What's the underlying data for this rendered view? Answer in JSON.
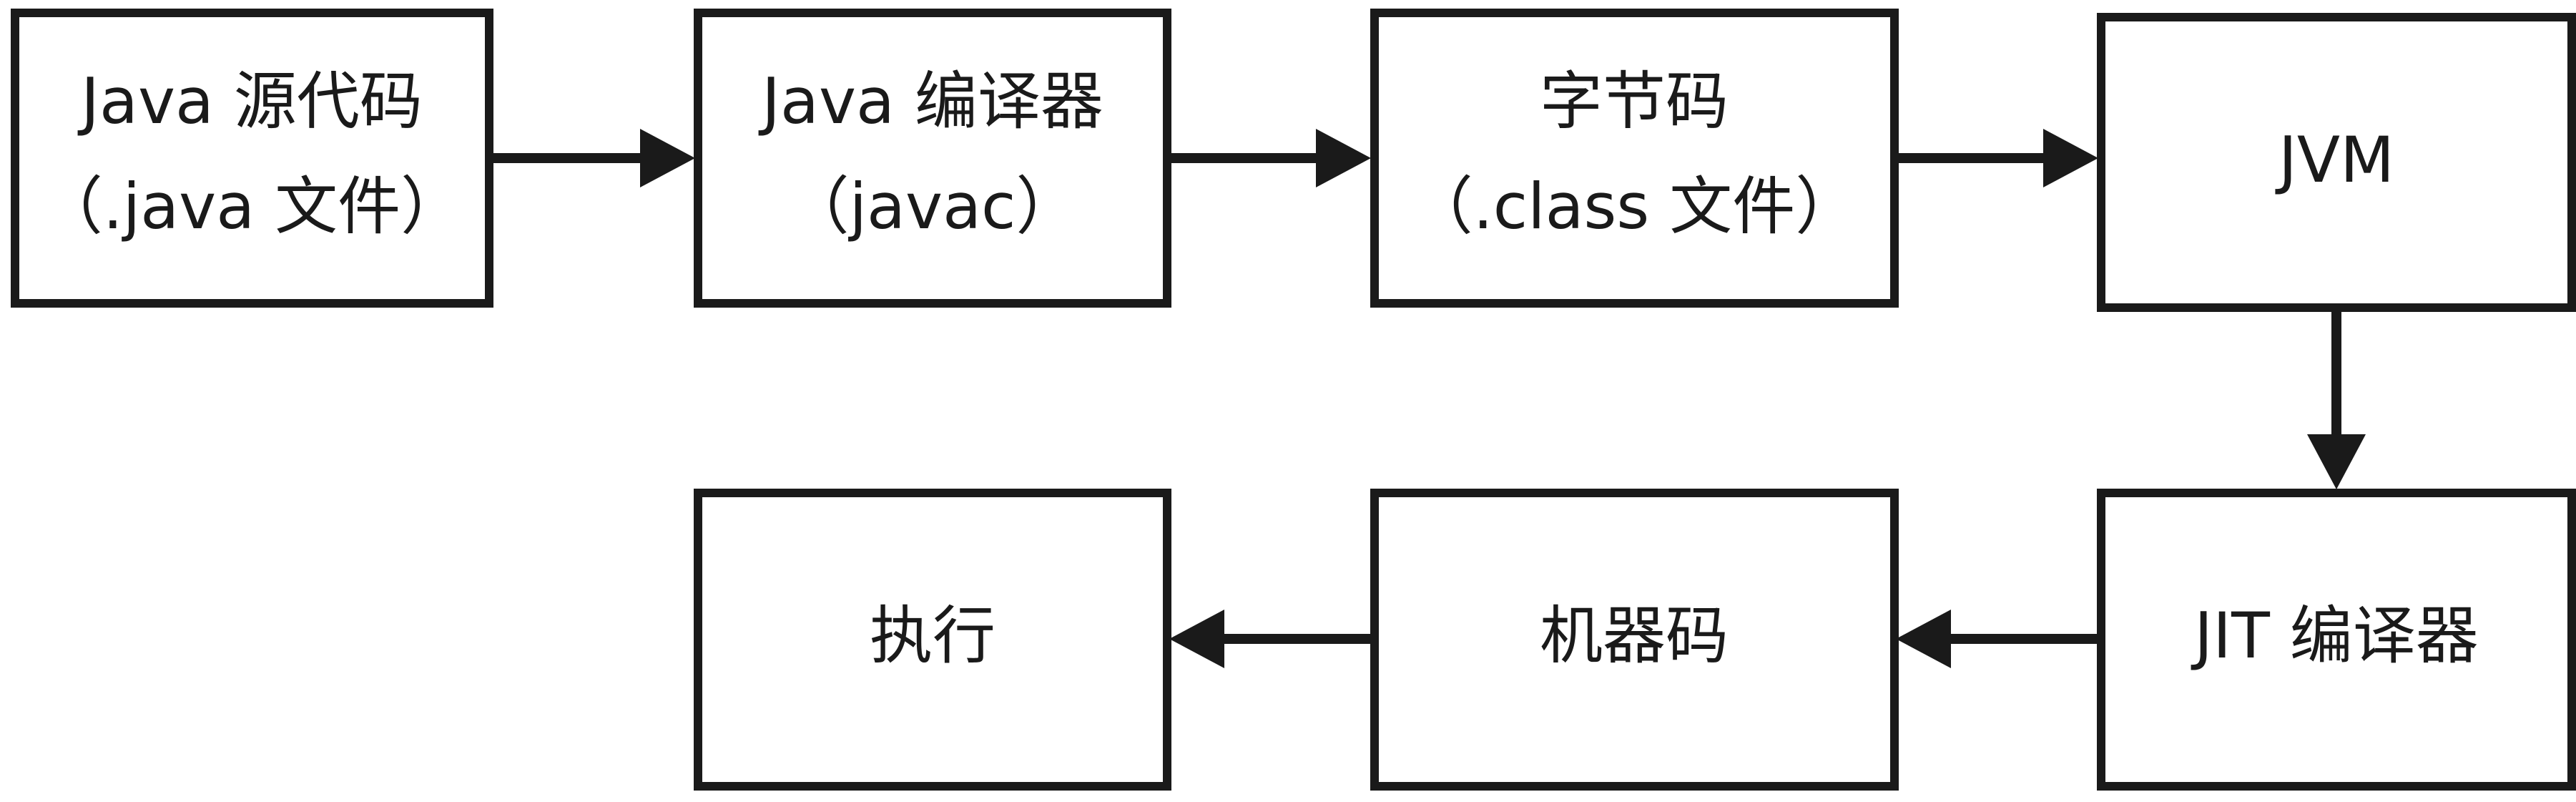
{
  "diagram": {
    "nodes": {
      "java_source": {
        "line1": "Java 源代码",
        "line2": "（.java 文件）"
      },
      "java_compiler": {
        "line1": "Java 编译器",
        "line2": "（javac）"
      },
      "bytecode": {
        "line1": "字节码",
        "line2": "（.class 文件）"
      },
      "jvm": {
        "label": "JVM"
      },
      "jit_compiler": {
        "label": "JIT 编译器"
      },
      "machine_code": {
        "label": "机器码"
      },
      "execute": {
        "label": "执行"
      }
    },
    "edges": [
      {
        "from": "java_source",
        "to": "java_compiler"
      },
      {
        "from": "java_compiler",
        "to": "bytecode"
      },
      {
        "from": "bytecode",
        "to": "jvm"
      },
      {
        "from": "jvm",
        "to": "jit_compiler"
      },
      {
        "from": "jit_compiler",
        "to": "machine_code"
      },
      {
        "from": "machine_code",
        "to": "execute"
      }
    ]
  }
}
